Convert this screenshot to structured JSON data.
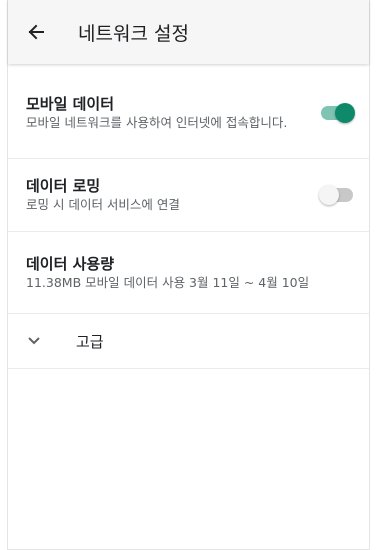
{
  "appbar": {
    "title": "네트워크 설정",
    "back_icon": "arrow-left-icon"
  },
  "settings": {
    "mobile_data": {
      "title": "모바일 데이터",
      "subtitle": "모바일 네트워크를 사용하여 인터넷에 접속합니다.",
      "enabled": true
    },
    "data_roaming": {
      "title": "데이터 로밍",
      "subtitle": "로밍 시 데이터 서비스에 연결",
      "enabled": false
    },
    "data_usage": {
      "title": "데이터 사용량",
      "subtitle": "11.38MB 모바일 데이터 사용 3월 11일 ~ 4월 10일"
    },
    "advanced": {
      "label": "고급",
      "icon": "chevron-down-icon"
    }
  },
  "colors": {
    "accent": "#0e8a6b",
    "accent_track": "#7fc3b3",
    "appbar_bg": "#f6f6f6"
  }
}
